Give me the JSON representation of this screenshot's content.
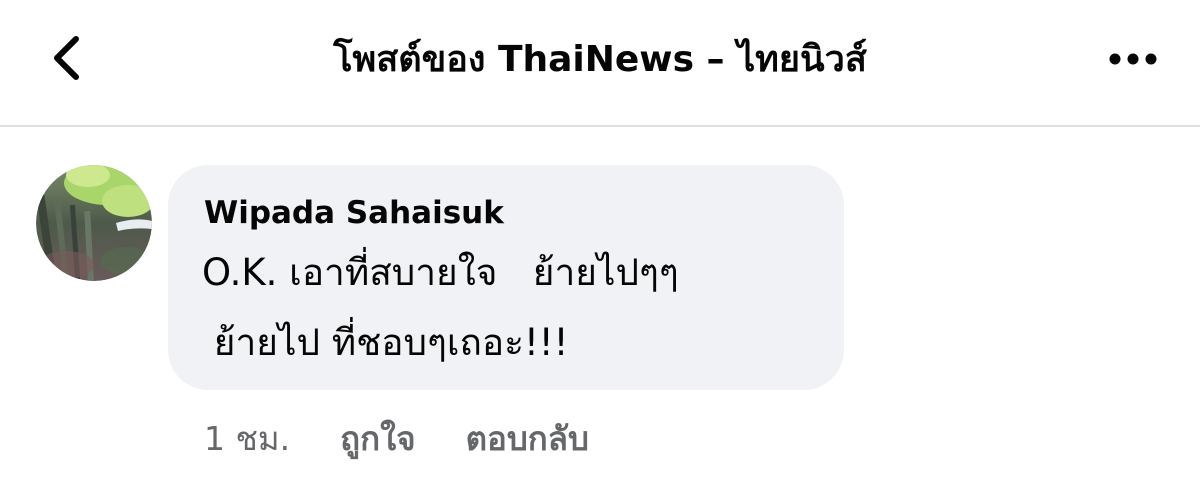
{
  "header": {
    "title": "โพสต์ของ ThaiNews – ไทยนิวส์",
    "back_icon": "chevron-left-icon",
    "more_icon": "more-horizontal-icon"
  },
  "comment": {
    "author": "Wipada Sahaisuk",
    "lines": [
      "O.K. เอาที่สบายใจ   ย้ายไปๆๆ",
      " ย้ายไป ที่ชอบๆเถอะ!!!"
    ],
    "time": "1 ชม.",
    "like_label": "ถูกใจ",
    "reply_label": "ตอบกลับ"
  },
  "colors": {
    "bubble": "#f0f2f5",
    "text": "#050505",
    "secondary_text": "#65676b",
    "divider": "#dddfe2"
  }
}
